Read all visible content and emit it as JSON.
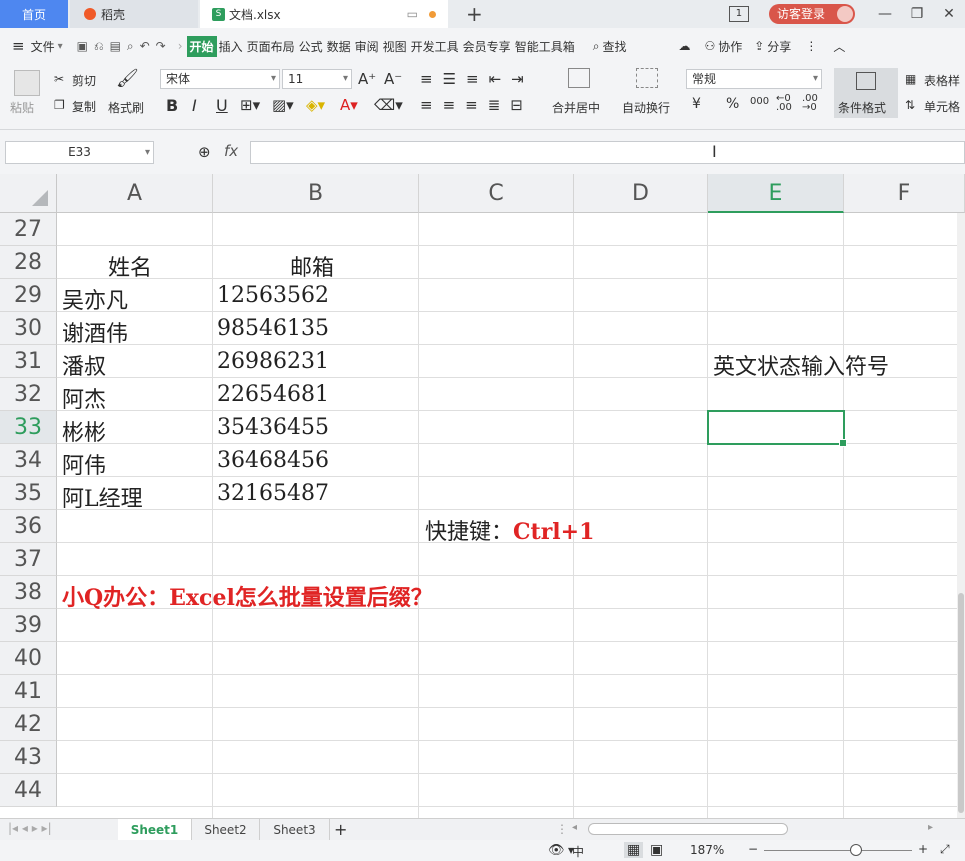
{
  "tabs": {
    "home": "首页",
    "daoke": "稻壳",
    "doc": "文档.xlsx",
    "new_tab": "+"
  },
  "title_right": {
    "badge": "1",
    "login": "访客登录",
    "minimize": "—",
    "restore": "❐",
    "close": "✕"
  },
  "menu": {
    "hamburger": "≡",
    "file": "文件",
    "items": [
      "开始",
      "插入",
      "页面布局",
      "公式",
      "数据",
      "审阅",
      "视图",
      "开发工具",
      "会员专享",
      "智能工具箱"
    ],
    "search": "查找",
    "collab": "协作",
    "share": "分享"
  },
  "ribbon": {
    "paste": "粘贴",
    "cut": "剪切",
    "copy": "复制",
    "format_painter": "格式刷",
    "font_name": "宋体",
    "font_size": "11",
    "merge_center": "合并居中",
    "wrap_text": "自动换行",
    "number_format": "常规",
    "conditional_format": "条件格式",
    "table_style": "表格样",
    "cell_style": "单元格",
    "bold": "B",
    "italic": "I",
    "underline": "U",
    "currency": "¥",
    "percent": "%",
    "thousands": "000"
  },
  "formula_bar": {
    "name_box": "E33",
    "fx": "fx",
    "content": ""
  },
  "columns": [
    "A",
    "B",
    "C",
    "D",
    "E",
    "F"
  ],
  "rows": [
    "27",
    "28",
    "29",
    "30",
    "31",
    "32",
    "33",
    "34",
    "35",
    "36",
    "37",
    "38",
    "39",
    "40",
    "41",
    "42",
    "43",
    "44"
  ],
  "active_cell": {
    "col": "E",
    "row": "33"
  },
  "cells": {
    "header_name": "姓名",
    "header_email": "邮箱",
    "records": [
      {
        "name": "吴亦凡",
        "email": "12563562"
      },
      {
        "name": "谢酒伟",
        "email": "98546135"
      },
      {
        "name": "潘叔",
        "email": "26986231"
      },
      {
        "name": "阿杰",
        "email": "22654681"
      },
      {
        "name": "彬彬",
        "email": "35436455"
      },
      {
        "name": "阿伟",
        "email": "36468456"
      },
      {
        "name": "阿L经理",
        "email": "32165487"
      }
    ],
    "note_e31": "英文状态输入符号",
    "shortcut_label": "快捷键：",
    "shortcut_value": "Ctrl+1",
    "title_a38": "小Q办公：Excel怎么批量设置后缀？"
  },
  "sheets": [
    "Sheet1",
    "Sheet2",
    "Sheet3"
  ],
  "add_sheet": "+",
  "status": {
    "zoom": "187%",
    "zoom_minus": "−",
    "zoom_plus": "+",
    "input_mode": "中"
  },
  "colors": {
    "accent": "#2e9d5d",
    "home_tab": "#4e87f0",
    "red_text": "#e02424"
  }
}
